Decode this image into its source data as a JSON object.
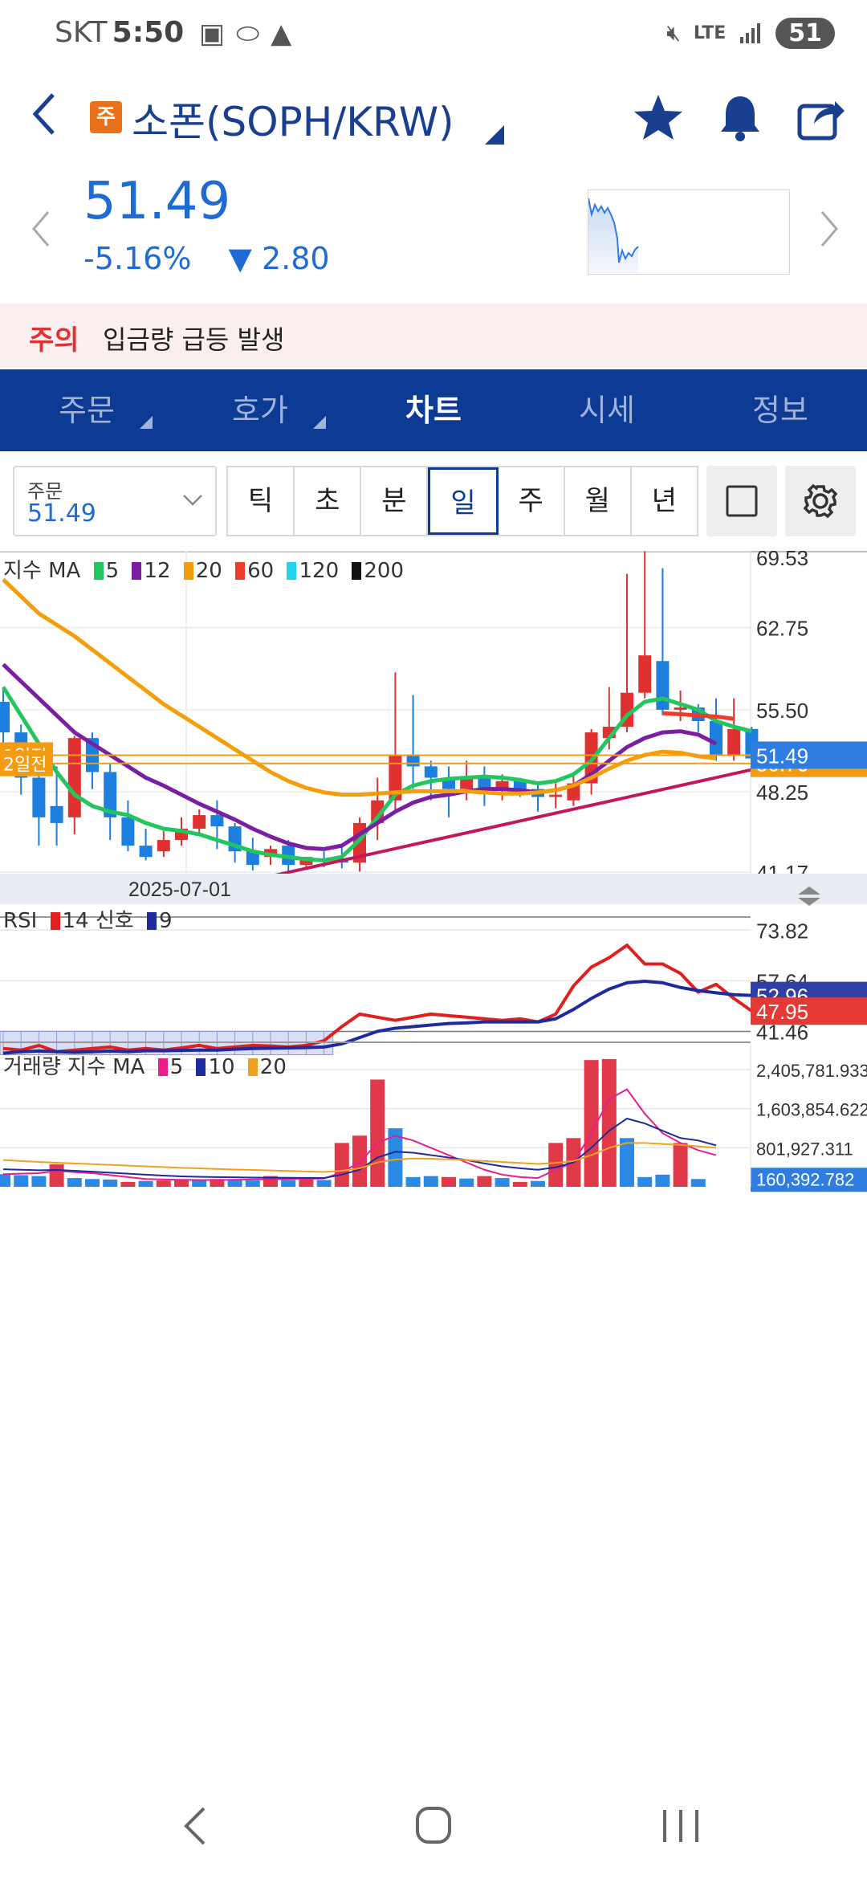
{
  "status_bar": {
    "carrier": "SKT",
    "time": "5:50",
    "network": "LTE",
    "battery": "51"
  },
  "header": {
    "badge": "주",
    "title": "소폰(SOPH/KRW)",
    "icons": [
      "back-icon",
      "star-icon",
      "bell-icon",
      "share-icon"
    ]
  },
  "price": {
    "current": "51.49",
    "change_pct": "-5.16%",
    "change_arrow": "▼",
    "change_abs": "2.80",
    "color": "#1e6bd6"
  },
  "notice": {
    "tag": "주의",
    "text": "입금량 급등 발생"
  },
  "tabs": [
    {
      "label": "주문",
      "active": false,
      "has_menu": true
    },
    {
      "label": "호가",
      "active": false,
      "has_menu": true
    },
    {
      "label": "차트",
      "active": true,
      "has_menu": false
    },
    {
      "label": "시세",
      "active": false,
      "has_menu": false
    },
    {
      "label": "정보",
      "active": false,
      "has_menu": false
    }
  ],
  "toolbar": {
    "order_label": "주문",
    "order_value": "51.49",
    "periods": [
      "틱",
      "초",
      "분",
      "일",
      "주",
      "월",
      "년"
    ],
    "active_period": "일"
  },
  "chart_data": [
    {
      "type": "candlestick",
      "legend": {
        "title": "지수 MA",
        "items": [
          {
            "label": "5",
            "color": "#22c55e"
          },
          {
            "label": "12",
            "color": "#7a1fa2"
          },
          {
            "label": "20",
            "color": "#f59e0b"
          },
          {
            "label": "60",
            "color": "#ef3b2a"
          },
          {
            "label": "120",
            "color": "#22d3ee"
          },
          {
            "label": "200",
            "color": "#111111"
          }
        ]
      },
      "y_ticks": [
        "69.53",
        "62.75",
        "55.50",
        "48.25",
        "41.17"
      ],
      "ylim": [
        41.17,
        69.53
      ],
      "x_label": "2025-07-01",
      "price_tags": [
        {
          "label": "51.49",
          "value": 51.49,
          "color": "#2f7de1"
        },
        {
          "label": "50.76",
          "value": 50.76,
          "color": "#f39c12"
        }
      ],
      "hlines": [
        {
          "label": "1일전",
          "value": 51.49,
          "color": "#f39c12"
        },
        {
          "label": "2일전",
          "value": 50.76,
          "color": "#f39c12"
        }
      ],
      "candles": [
        {
          "o": 56.2,
          "h": 57.5,
          "c": 53.5,
          "l": 51.5
        },
        {
          "o": 53.5,
          "h": 54.2,
          "c": 49.5,
          "l": 48.0
        },
        {
          "o": 49.5,
          "h": 50.5,
          "c": 46.0,
          "l": 43.5
        },
        {
          "o": 47.0,
          "h": 50.5,
          "c": 45.5,
          "l": 43.5
        },
        {
          "o": 46.0,
          "h": 53.2,
          "c": 53.0,
          "l": 44.5
        },
        {
          "o": 53.0,
          "h": 53.5,
          "c": 50.0,
          "l": 48.5
        },
        {
          "o": 50.0,
          "h": 50.8,
          "c": 46.0,
          "l": 44.0
        },
        {
          "o": 46.0,
          "h": 47.5,
          "c": 43.5,
          "l": 43.0
        },
        {
          "o": 43.5,
          "h": 45.0,
          "c": 42.5,
          "l": 42.2
        },
        {
          "o": 43.0,
          "h": 44.8,
          "c": 44.0,
          "l": 42.5
        },
        {
          "o": 44.0,
          "h": 46.0,
          "c": 45.0,
          "l": 43.5
        },
        {
          "o": 45.0,
          "h": 46.7,
          "c": 46.2,
          "l": 44.5
        },
        {
          "o": 46.2,
          "h": 47.5,
          "c": 45.2,
          "l": 43.2
        },
        {
          "o": 45.2,
          "h": 45.5,
          "c": 43.0,
          "l": 42.0
        },
        {
          "o": 43.0,
          "h": 44.2,
          "c": 41.8,
          "l": 41.3
        },
        {
          "o": 42.5,
          "h": 43.5,
          "c": 43.2,
          "l": 41.8
        },
        {
          "o": 43.5,
          "h": 44.0,
          "c": 41.8,
          "l": 40.8
        },
        {
          "o": 41.8,
          "h": 42.5,
          "c": 42.5,
          "l": 41.5
        },
        {
          "o": 42.3,
          "h": 43.0,
          "c": 42.2,
          "l": 41.6
        },
        {
          "o": 42.2,
          "h": 43.5,
          "c": 42.0,
          "l": 41.5
        },
        {
          "o": 42.0,
          "h": 46.0,
          "c": 45.5,
          "l": 41.2
        },
        {
          "o": 45.5,
          "h": 49.5,
          "c": 47.5,
          "l": 44.0
        },
        {
          "o": 47.5,
          "h": 58.8,
          "c": 51.5,
          "l": 46.5
        },
        {
          "o": 51.5,
          "h": 56.8,
          "c": 50.5,
          "l": 48.5
        },
        {
          "o": 50.5,
          "h": 51.0,
          "c": 49.5,
          "l": 47.5
        },
        {
          "o": 49.5,
          "h": 50.5,
          "c": 48.5,
          "l": 46.0
        },
        {
          "o": 48.5,
          "h": 51.0,
          "c": 49.5,
          "l": 47.5
        },
        {
          "o": 49.5,
          "h": 50.5,
          "c": 48.5,
          "l": 47.0
        },
        {
          "o": 48.5,
          "h": 49.8,
          "c": 49.2,
          "l": 47.5
        },
        {
          "o": 49.2,
          "h": 49.5,
          "c": 48.5,
          "l": 47.8
        },
        {
          "o": 48.5,
          "h": 49.0,
          "c": 47.8,
          "l": 46.5
        },
        {
          "o": 47.8,
          "h": 49.0,
          "c": 48.0,
          "l": 46.8
        },
        {
          "o": 47.5,
          "h": 49.8,
          "c": 49.0,
          "l": 47.0
        },
        {
          "o": 49.0,
          "h": 53.8,
          "c": 53.5,
          "l": 48.0
        },
        {
          "o": 53.0,
          "h": 57.5,
          "c": 54.0,
          "l": 52.0
        },
        {
          "o": 54.0,
          "h": 67.5,
          "c": 57.0,
          "l": 53.5
        },
        {
          "o": 57.0,
          "h": 69.5,
          "c": 60.3,
          "l": 56.5
        },
        {
          "o": 59.8,
          "h": 68.0,
          "c": 55.5,
          "l": 55.0
        },
        {
          "o": 55.5,
          "h": 57.2,
          "c": 55.7,
          "l": 54.5
        },
        {
          "o": 55.7,
          "h": 56.0,
          "c": 54.5,
          "l": 53.5
        },
        {
          "o": 54.5,
          "h": 56.5,
          "c": 51.5,
          "l": 51.0
        },
        {
          "o": 51.5,
          "h": 56.5,
          "c": 53.8,
          "l": 51.0
        },
        {
          "o": 53.8,
          "h": 54.0,
          "c": 51.2,
          "l": 50.3
        }
      ],
      "ma": {
        "5": [
          57.5,
          55.0,
          52.5,
          50.0,
          48.0,
          47.0,
          46.5,
          46.2,
          45.5,
          45.0,
          44.8,
          44.5,
          44.0,
          43.5,
          43.0,
          42.7,
          42.5,
          42.3,
          42.2,
          42.5,
          44.0,
          46.0,
          48.0,
          48.8,
          49.2,
          49.4,
          49.5,
          49.6,
          49.5,
          49.3,
          49.0,
          49.2,
          49.8,
          51.0,
          53.0,
          55.0,
          56.2,
          56.5,
          56.0,
          55.5,
          54.5,
          54.0,
          53.6
        ],
        "12": [
          59.5,
          58.0,
          56.5,
          55.0,
          53.5,
          52.5,
          51.5,
          50.5,
          49.5,
          48.8,
          48.0,
          47.2,
          46.5,
          45.8,
          45.0,
          44.3,
          43.7,
          43.3,
          43.2,
          43.5,
          44.5,
          45.5,
          46.5,
          47.3,
          47.8,
          48.0,
          48.3,
          48.5,
          48.5,
          48.4,
          48.2,
          48.4,
          48.8,
          49.8,
          51.0,
          52.2,
          53.0,
          53.5,
          53.6,
          53.3,
          52.5
        ],
        "20": [
          67.0,
          65.5,
          64.0,
          63.0,
          62.0,
          60.8,
          59.6,
          58.4,
          57.2,
          56.0,
          55.0,
          54.0,
          53.0,
          52.0,
          51.0,
          50.0,
          49.2,
          48.6,
          48.2,
          48.0,
          48.0,
          48.1,
          48.2,
          48.3,
          48.3,
          48.3,
          48.3,
          48.2,
          48.1,
          48.1,
          48.2,
          48.4,
          48.8,
          49.5,
          50.3,
          51.0,
          51.5,
          51.8,
          51.7,
          51.4,
          51.2
        ],
        "60": [
          55.2,
          55.1,
          55.0,
          54.9,
          54.7
        ]
      },
      "trendline": {
        "from": [
          15,
          40.8
        ],
        "to": [
          48,
          52.3
        ],
        "color": "#c2185b"
      }
    },
    {
      "type": "line",
      "legend": {
        "title": "RSI",
        "items": [
          {
            "label": "14 신호",
            "color": "#e02020"
          },
          {
            "label": "9",
            "color": "#1f2a9c"
          }
        ]
      },
      "y_ticks": [
        "73.82",
        "57.64",
        "41.46"
      ],
      "ylim": [
        38,
        78
      ],
      "tags": [
        {
          "label": "52.96",
          "value": 52.96,
          "color": "#2f3fa8"
        },
        {
          "label": "47.95",
          "value": 47.95,
          "color": "#e53935"
        }
      ],
      "series": [
        {
          "name": "14 신호",
          "color": "#e02020",
          "values": [
            36,
            35.5,
            37,
            35,
            35.5,
            36,
            36.5,
            35.5,
            36,
            35.5,
            36.2,
            37,
            36,
            36.5,
            37,
            36.8,
            36.5,
            37,
            38.5,
            43,
            47,
            46,
            45,
            46,
            47,
            46.5,
            46,
            45.5,
            45,
            45.5,
            44.5,
            47,
            56,
            62,
            65,
            69,
            63,
            63,
            60,
            54,
            56.5,
            52,
            48
          ]
        },
        {
          "name": "9",
          "color": "#1f2a9c",
          "values": [
            34.5,
            35,
            35.2,
            35,
            34.8,
            35,
            35.2,
            35,
            35.3,
            35.3,
            35.4,
            35.5,
            35.5,
            35.8,
            36,
            36.1,
            36.2,
            36.3,
            36.5,
            37.5,
            39.5,
            41.5,
            42.5,
            43,
            43.5,
            44,
            44.2,
            44.5,
            44.5,
            44.5,
            44.5,
            45.5,
            48.5,
            52,
            55,
            57,
            57.5,
            57,
            55.5,
            54.5,
            53.8,
            53.2,
            52.96
          ]
        }
      ]
    },
    {
      "type": "bar",
      "legend": {
        "title": "거래량 지수 MA",
        "items": [
          {
            "label": "5",
            "color": "#e91e8c"
          },
          {
            "label": "10",
            "color": "#1f2a9c"
          },
          {
            "label": "20",
            "color": "#f0a020"
          }
        ]
      },
      "y_ticks": [
        "2,405,781.933",
        "1,603,854.622",
        "801,927.311",
        "160,392.782"
      ],
      "ylim": [
        0,
        2800000
      ],
      "tag": {
        "label": "160,392.782",
        "value": 160392.782,
        "color": "#2f7de1"
      },
      "bars": [
        {
          "v": 260000,
          "up": false
        },
        {
          "v": 240000,
          "up": false
        },
        {
          "v": 220000,
          "up": false
        },
        {
          "v": 460000,
          "up": true
        },
        {
          "v": 180000,
          "up": false
        },
        {
          "v": 160000,
          "up": false
        },
        {
          "v": 150000,
          "up": false
        },
        {
          "v": 100000,
          "up": true
        },
        {
          "v": 120000,
          "up": false
        },
        {
          "v": 130000,
          "up": true
        },
        {
          "v": 150000,
          "up": true
        },
        {
          "v": 140000,
          "up": false
        },
        {
          "v": 160000,
          "up": true
        },
        {
          "v": 150000,
          "up": false
        },
        {
          "v": 130000,
          "up": false
        },
        {
          "v": 220000,
          "up": true
        },
        {
          "v": 140000,
          "up": false
        },
        {
          "v": 150000,
          "up": true
        },
        {
          "v": 140000,
          "up": false
        },
        {
          "v": 900000,
          "up": true
        },
        {
          "v": 1050000,
          "up": true
        },
        {
          "v": 2200000,
          "up": true
        },
        {
          "v": 1200000,
          "up": false
        },
        {
          "v": 200000,
          "up": false
        },
        {
          "v": 220000,
          "up": false
        },
        {
          "v": 200000,
          "up": true
        },
        {
          "v": 170000,
          "up": false
        },
        {
          "v": 220000,
          "up": true
        },
        {
          "v": 180000,
          "up": false
        },
        {
          "v": 100000,
          "up": true
        },
        {
          "v": 120000,
          "up": false
        },
        {
          "v": 900000,
          "up": true
        },
        {
          "v": 1000000,
          "up": true
        },
        {
          "v": 2600000,
          "up": true
        },
        {
          "v": 2620000,
          "up": true
        },
        {
          "v": 1000000,
          "up": false
        },
        {
          "v": 200000,
          "up": false
        },
        {
          "v": 250000,
          "up": false
        },
        {
          "v": 900000,
          "up": true
        },
        {
          "v": 160000,
          "up": false
        }
      ],
      "ma": {
        "5": [
          260000,
          270000,
          280000,
          330000,
          300000,
          280000,
          240000,
          200000,
          160000,
          150000,
          145000,
          140000,
          140000,
          145000,
          150000,
          155000,
          160000,
          165000,
          170000,
          300000,
          500000,
          900000,
          1050000,
          950000,
          800000,
          650000,
          500000,
          350000,
          250000,
          200000,
          180000,
          350000,
          500000,
          1100000,
          1800000,
          2000000,
          1500000,
          1100000,
          900000,
          750000,
          650000
        ],
        "10": [
          360000,
          350000,
          340000,
          345000,
          330000,
          310000,
          290000,
          270000,
          250000,
          230000,
          215000,
          205000,
          200000,
          195000,
          190000,
          188000,
          185000,
          183000,
          181000,
          250000,
          350000,
          600000,
          720000,
          700000,
          650000,
          600000,
          550000,
          480000,
          420000,
          380000,
          350000,
          400000,
          500000,
          800000,
          1150000,
          1400000,
          1300000,
          1150000,
          1000000,
          950000,
          850000
        ],
        "20": [
          550000,
          530000,
          510000,
          495000,
          480000,
          465000,
          450000,
          435000,
          420000,
          405000,
          390000,
          378000,
          366000,
          355000,
          345000,
          335000,
          325000,
          315000,
          305000,
          330000,
          380000,
          500000,
          560000,
          580000,
          575000,
          565000,
          550000,
          530000,
          510000,
          490000,
          470000,
          490000,
          530000,
          650000,
          800000,
          900000,
          900000,
          880000,
          860000,
          830000,
          800000
        ]
      }
    }
  ],
  "bottom_nav": [
    "back-nav-icon",
    "home-nav-icon",
    "recents-nav-icon"
  ]
}
